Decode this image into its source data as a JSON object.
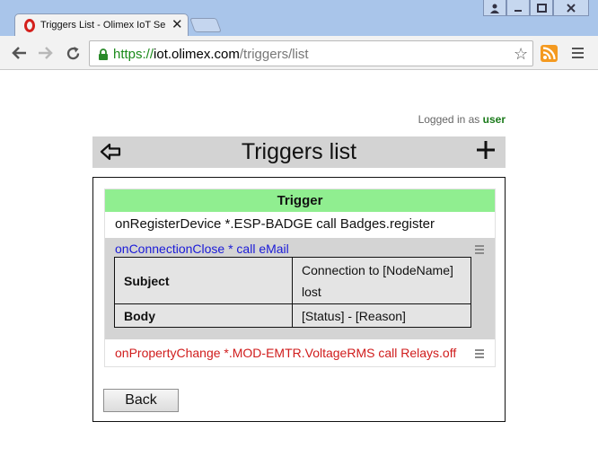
{
  "browser": {
    "tab_title": "Triggers List - Olimex IoT Ser",
    "tab_close_icon": "close-icon",
    "url_scheme": "https://",
    "url_host": "iot.olimex.com",
    "url_path": "/triggers/list",
    "star_glyph": "☆",
    "close_glyph": "✕"
  },
  "page": {
    "login_prefix": "Logged in as",
    "login_user": "user",
    "title": "Triggers list",
    "back_icon": "back-arrow-icon",
    "add_icon": "plus-icon",
    "table_header": "Trigger",
    "triggers": [
      {
        "text": "onRegisterDevice *.ESP-BADGE call Badges.register",
        "color": "#111111"
      },
      {
        "text": "onConnectionClose * call eMail",
        "color": "#1a1ad8"
      },
      {
        "text": "onPropertyChange *.MOD-EMTR.VoltageRMS call Relays.off",
        "color": "#d01c1c"
      }
    ],
    "details": [
      {
        "key": "Subject",
        "value": "Connection to [NodeName] lost"
      },
      {
        "key": "Body",
        "value": "[Status] - [Reason]"
      }
    ],
    "back_button": "Back"
  }
}
